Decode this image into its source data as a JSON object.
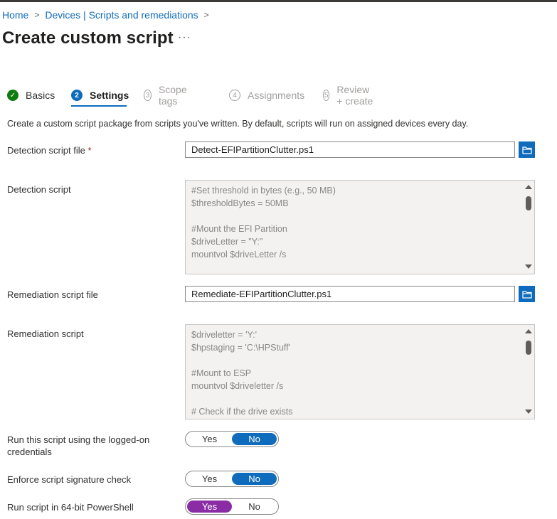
{
  "breadcrumb": [
    {
      "label": "Home"
    },
    {
      "label": "Devices | Scripts and remediations"
    }
  ],
  "page": {
    "title": "Create custom script",
    "more_label": "···"
  },
  "wizard": {
    "steps": [
      {
        "number": "✓",
        "label": "Basics",
        "state": "done"
      },
      {
        "number": "2",
        "label": "Settings",
        "state": "active"
      },
      {
        "number": "3",
        "label": "Scope tags",
        "state": "pending"
      },
      {
        "number": "4",
        "label": "Assignments",
        "state": "pending"
      },
      {
        "number": "5",
        "label": "Review + create",
        "state": "pending"
      }
    ]
  },
  "description": "Create a custom script package from scripts you've written. By default, scripts will run on assigned devices every day.",
  "detection": {
    "file_label": "Detection script file",
    "required_mark": "*",
    "file_value": "Detect-EFIPartitionClutter.ps1",
    "script_label": "Detection script",
    "script_lines": [
      "#Set threshold in bytes (e.g., 50 MB)",
      "$thresholdBytes = 50MB",
      "",
      "#Mount the EFI Partition",
      "$driveLetter = \"Y:\"",
      "mountvol $driveLetter /s"
    ]
  },
  "remediation": {
    "file_label": "Remediation script file",
    "file_value": "Remediate-EFIPartitionClutter.ps1",
    "script_label": "Remediation script",
    "script_lines": [
      "$driveletter = 'Y:'",
      "$hpstaging = 'C:\\HPStuff'",
      "",
      "#Mount to ESP",
      "mountvol $driveletter /s",
      "",
      "# Check if the drive exists"
    ]
  },
  "options": [
    {
      "label": "Run this script using the logged-on credentials",
      "yes": "Yes",
      "no": "No",
      "selected": "No"
    },
    {
      "label": "Enforce script signature check",
      "yes": "Yes",
      "no": "No",
      "selected": "No"
    },
    {
      "label": "Run script in 64-bit PowerShell",
      "yes": "Yes",
      "no": "No",
      "selected": "Yes"
    }
  ],
  "colors": {
    "accent": "#0f6cbd",
    "success": "#107c10",
    "toggle_yes_selected": "#8a2da5",
    "required": "#a4262c"
  },
  "icons": {
    "browse": "folder-icon",
    "done_step": "checkmark-icon",
    "more": "ellipsis-icon"
  }
}
